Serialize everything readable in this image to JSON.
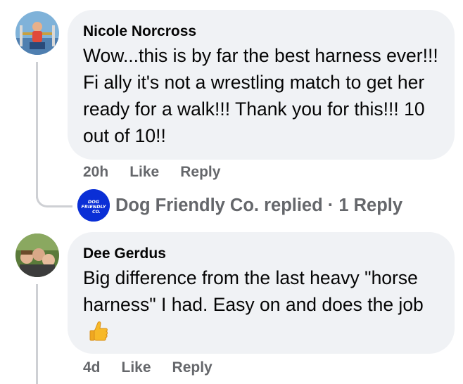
{
  "comments": [
    {
      "author": "Nicole Norcross",
      "text": "Wow...this is by far the best harness ever!!! Fi ally it's not a wrestling match to get her ready for a walk!!! Thank you for this!!! 10 out of 10!!",
      "time": "20h",
      "like_label": "Like",
      "reply_label": "Reply",
      "replies": {
        "avatar_text": "DOG FRIENDLY CO.",
        "summary": "Dog Friendly Co. replied · 1 Reply"
      }
    },
    {
      "author": "Dee Gerdus",
      "text": "Big difference from the last heavy \"horse harness\" I had. Easy on and does the job",
      "emoji": "thumbs-up-icon",
      "time": "4d",
      "like_label": "Like",
      "reply_label": "Reply"
    }
  ],
  "colors": {
    "bubble": "#f0f2f5",
    "text": "#050505",
    "secondary": "#65676b",
    "thread_line": "#ced0d4",
    "brand_avatar": "#0a2fd6"
  }
}
